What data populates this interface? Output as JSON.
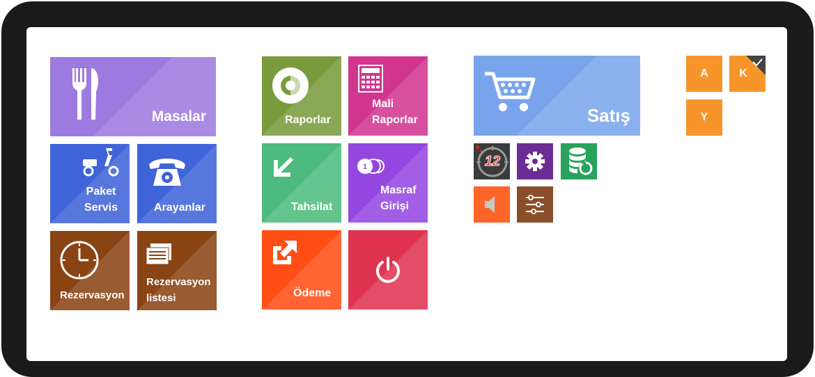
{
  "tiles": {
    "masalar": {
      "label": "Masalar",
      "color": "#9d7ae0",
      "icon": "fork-knife-icon"
    },
    "paket_servis": {
      "line1": "Paket",
      "line2": "Servis",
      "color": "#3f63d8",
      "icon": "scooter-icon"
    },
    "arayanlar": {
      "label": "Arayanlar",
      "color": "#3f63d8",
      "icon": "telephone-icon"
    },
    "rezervasyon": {
      "label": "Rezervasyon",
      "color": "#8a4313",
      "icon": "clock-icon"
    },
    "rezervasyon_listesi": {
      "line1": "Rezervasyon",
      "line2": "listesi",
      "color": "#8a4313",
      "icon": "list-icon"
    },
    "raporlar": {
      "label": "Raporlar",
      "color": "#7a9b3d",
      "icon": "pie-chart-icon"
    },
    "mali_raporlar": {
      "line1": "Mali",
      "line2": "Raporlar",
      "color": "#d1358f",
      "icon": "calculator-icon"
    },
    "tahsilat": {
      "label": "Tahsilat",
      "color": "#4cbb7d",
      "icon": "arrow-down-left-icon"
    },
    "masraf_girisi": {
      "line1": "Masraf",
      "line2": "Girişi",
      "color": "#9446e0",
      "icon": "coins-icon"
    },
    "odeme": {
      "label": "Ödeme",
      "color": "#ff4d14",
      "icon": "arrow-up-right-icon"
    },
    "power": {
      "color": "#e0334f",
      "icon": "power-icon"
    },
    "satis": {
      "label": "Satış",
      "color": "#79a4ec",
      "icon": "shopping-cart-icon"
    }
  },
  "small_tiles": {
    "day_counter": {
      "text": "12",
      "color": "#3b3b3b",
      "icon": "day-counter-icon"
    },
    "settings": {
      "color": "#6a2d94",
      "icon": "gear-icon"
    },
    "database": {
      "color": "#27a35a",
      "icon": "database-refresh-icon"
    },
    "sound": {
      "color": "#ff6428",
      "icon": "speaker-icon"
    },
    "sliders": {
      "color": "#8a4f2a",
      "icon": "sliders-icon"
    }
  },
  "letters": {
    "a": "A",
    "k": "K",
    "y": "Y",
    "color": "#f7952b"
  }
}
